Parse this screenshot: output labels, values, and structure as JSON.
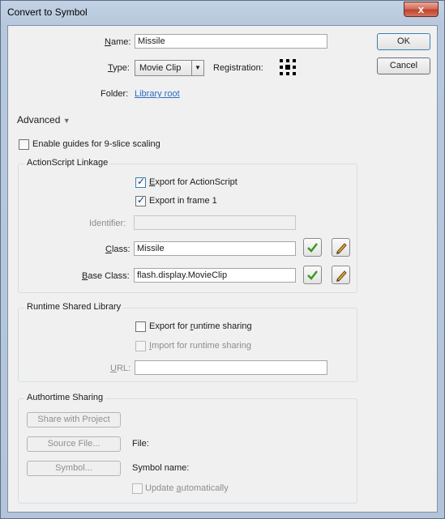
{
  "window": {
    "title": "Convert to Symbol",
    "close_glyph": "x"
  },
  "buttons": {
    "ok": "OK",
    "cancel": "Cancel"
  },
  "name": {
    "label_prefix": "",
    "label_u": "N",
    "label_rest": "ame:",
    "value": "Missile"
  },
  "type": {
    "label_u": "T",
    "label_rest": "ype:",
    "value": "Movie Clip"
  },
  "registration": {
    "label": "Registration:"
  },
  "folder": {
    "label": "Folder:",
    "value": "Library root"
  },
  "advanced": {
    "label": "Advanced"
  },
  "nine_slice": {
    "label_pre": "Enable ",
    "label_u": "g",
    "label_rest": "uides for 9-slice scaling",
    "checked": false
  },
  "actionscript": {
    "title": "ActionScript Linkage",
    "export_as": {
      "label_u": "E",
      "label_rest": "xport for ActionScript",
      "checked": true
    },
    "export_frame": {
      "label": "Export in frame 1",
      "checked": true
    },
    "identifier": {
      "label": "Identifier:",
      "value": ""
    },
    "class": {
      "label_u": "C",
      "label_rest": "lass:",
      "value": "Missile"
    },
    "base_class": {
      "label_u": "B",
      "label_rest": "ase Class:",
      "value": "flash.display.MovieClip"
    }
  },
  "runtime": {
    "title": "Runtime Shared Library",
    "export": {
      "label_pre": "Export for ",
      "label_u": "r",
      "label_rest": "untime sharing",
      "checked": false
    },
    "import": {
      "label_u": "I",
      "label_rest": "mport for runtime sharing",
      "checked": false
    },
    "url": {
      "label_u": "U",
      "label_rest": "RL:",
      "value": ""
    }
  },
  "authortime": {
    "title": "Authortime Sharing",
    "share_btn": "Share with Project",
    "source_btn": "Source File...",
    "file_label": "File:",
    "symbol_btn": "Symbol...",
    "symbol_name_label": "Symbol name:",
    "update": {
      "label_pre": "Update ",
      "label_u": "a",
      "label_rest": "utomatically",
      "checked": false
    }
  },
  "icons": {
    "validate": "checkmark-icon",
    "edit": "pencil-icon"
  },
  "colors": {
    "link": "#2b6ec4",
    "check_green": "#3a9a1e"
  }
}
